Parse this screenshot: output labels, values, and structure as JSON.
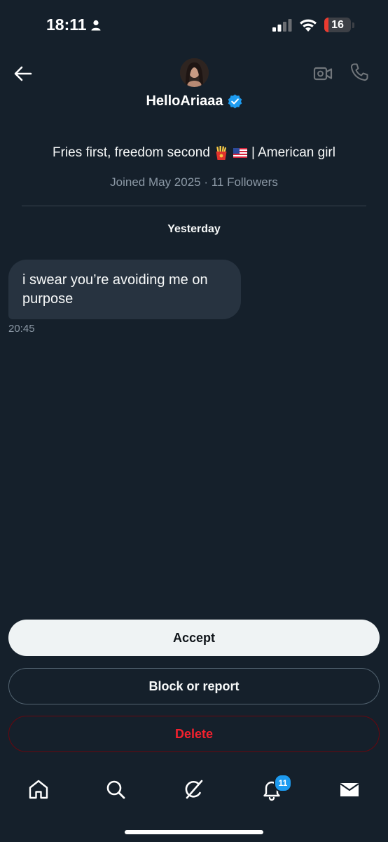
{
  "status_bar": {
    "time": "18:11",
    "battery": "16",
    "battery_level": 0.16
  },
  "header": {
    "back_icon": "arrow-left-icon",
    "name": "HelloAriaaa",
    "verified_icon": "verified-badge-icon",
    "video_icon": "video-camera-icon",
    "phone_icon": "phone-icon"
  },
  "profile": {
    "bio_before": "Fries first, freedom second",
    "bio_after": "| American girl",
    "meta": "Joined May 2025 · 11 Followers"
  },
  "conversation": {
    "date_separator": "Yesterday",
    "messages": [
      {
        "text": "i swear you’re avoiding me on purpose",
        "time": "20:45"
      }
    ]
  },
  "actions": {
    "accept": "Accept",
    "block": "Block or report",
    "delete": "Delete"
  },
  "nav": {
    "items": [
      "home-icon",
      "search-icon",
      "grok-icon",
      "notifications-icon",
      "messages-icon"
    ],
    "notif_count": "11"
  },
  "colors": {
    "background": "#15202b",
    "accent": "#1d9bf0",
    "danger": "#f4212e",
    "bubble": "#273340"
  }
}
